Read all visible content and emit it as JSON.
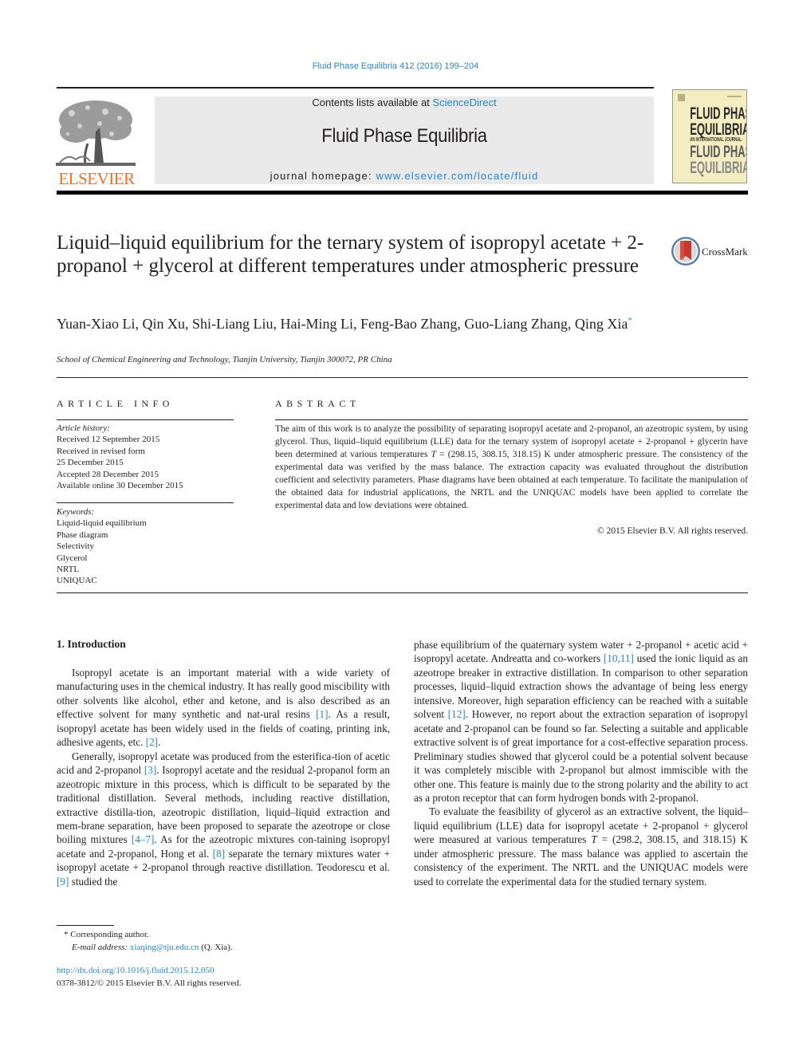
{
  "header": {
    "journal_reference": "Fluid Phase Equilibria 412 (2016) 199–204",
    "contents_prefix": "Contents lists available at ",
    "contents_link": "ScienceDirect",
    "journal_title": "Fluid Phase Equilibria",
    "homepage_prefix": "journal homepage: ",
    "homepage_link": "www.elsevier.com/locate/fluid",
    "publisher_logo_text": "ELSEVIER",
    "cover": {
      "lines": [
        "FLUID PHASE",
        "EQUILIBRIA",
        "AN INTERNATIONAL JOURNAL",
        "FLUID PHASE",
        "EQUILIBRIA"
      ]
    },
    "colors": {
      "link": "#2a85c6",
      "elsevier_orange": "#f37021",
      "banner_bg": "#e9e9e9",
      "cover_bg": "#f5edc2"
    }
  },
  "article": {
    "title": "Liquid–liquid equilibrium for the ternary system of isopropyl acetate + 2-propanol + glycerol at different temperatures under atmospheric pressure",
    "crossmark_label": "CrossMark",
    "authors": "Yuan-Xiao Li, Qin Xu, Shi-Liang Liu, Hai-Ming Li, Feng-Bao Zhang, Guo-Liang Zhang, Qing Xia",
    "corresponding_mark": "*",
    "affiliation": "School of Chemical Engineering and Technology, Tianjin University, Tianjin 300072, PR China"
  },
  "article_info": {
    "heading": "ARTICLE INFO",
    "history_label": "Article history:",
    "history": [
      "Received 12 September 2015",
      "Received in revised form",
      "25 December 2015",
      "Accepted 28 December 2015",
      "Available online 30 December 2015"
    ],
    "keywords_label": "Keywords:",
    "keywords": [
      "Liquid-liquid equilibrium",
      "Phase diagram",
      "Selectivity",
      "Glycerol",
      "NRTL",
      "UNIQUAC"
    ]
  },
  "abstract": {
    "heading": "ABSTRACT",
    "text_1": "The aim of this work is to analyze the possibility of separating isopropyl acetate and 2-propanol, an azeotropic system, by using glycerol. Thus, liquid–liquid equilibrium (LLE) data for the ternary system of isopropyl acetate + 2-propanol + glycerin have been determined at various temperatures ",
    "text_T": "T",
    "text_2": " = (298.15, 308.15, 318.15) K under atmospheric pressure. The consistency of the experimental data was verified by the mass balance. The extraction capacity was evaluated throughout the distribution coefficient and selectivity parameters. Phase diagrams have been obtained at each temperature. To facilitate the manipulation of the obtained data for industrial applications, the NRTL and the UNIQUAC models have been applied to correlate the experimental data and low deviations were obtained.",
    "copyright": "© 2015 Elsevier B.V. All rights reserved."
  },
  "introduction": {
    "heading": "1.  Introduction",
    "p1": [
      {
        "t": "Isopropyl acetate is an important material with a wide variety of manufacturing uses in the chemical industry. It has really good miscibility with other solvents like alcohol, ether and ketone, and is also described as an effective solvent for many synthetic and natural resins "
      },
      {
        "ref": "[1]"
      },
      {
        "t": ". As a result, isopropyl acetate has been widely used in the fields of coating, printing ink, adhesive agents, etc. "
      },
      {
        "ref": "[2]"
      },
      {
        "t": "."
      }
    ],
    "p2": [
      {
        "t": "Generally, isopropyl acetate was produced from the esterification of acetic acid and 2-propanol "
      },
      {
        "ref": "[3]"
      },
      {
        "t": ". Isopropyl acetate and the residual 2-propanol form an azeotropic mixture in this process, which is difficult to be separated by the traditional distillation. Several methods, including reactive distillation, extractive distillation, azeotropic distillation, liquid–liquid extraction and membrane separation, have been proposed to separate the azeotrope or close boiling mixtures "
      },
      {
        "ref": "[4–7]"
      },
      {
        "t": ". As for the azeotropic mixtures containing isopropyl acetate and 2-propanol, Hong et al. "
      },
      {
        "ref": "[8]"
      },
      {
        "t": " separate the ternary mixtures water + isopropyl acetate + 2-propanol through reactive distillation. Teodorescu et al. "
      },
      {
        "ref": "[9]"
      },
      {
        "t": " studied the phase equilibrium of the quaternary system water + 2-propanol + acetic acid + isopropyl acetate. Andreatta and co-workers "
      },
      {
        "ref": "[10,11]"
      },
      {
        "t": " used the ionic liquid as an azeotrope breaker in extractive distillation. In comparison to other separation processes, liquid–liquid extraction shows the advantage of being less energy intensive. Moreover, high separation efficiency can be reached with a suitable solvent "
      },
      {
        "ref": "[12]"
      },
      {
        "t": ". However, no report about the extraction separation of isopropyl acetate and 2-propanol can be found so far. Selecting a suitable and applicable extractive solvent is of great importance for a cost-effective separation process. Preliminary studies showed that glycerol could be a potential solvent because it was completely miscible with 2-propanol but almost immiscible with the other one. This feature is mainly due to the strong polarity and the ability to act as a proton receptor that can form hydrogen bonds with 2-propanol."
      }
    ],
    "p2_left_part": "Generally, isopropyl acetate was produced from the esterifica-tion of acetic acid and 2-propanol",
    "p3": [
      {
        "t": "To evaluate the feasibility of glycerol as an extractive solvent, the liquid–liquid equilibrium (LLE) data for isopropyl acetate + 2-propanol + glycerol were measured at various temperatures "
      },
      {
        "em": "T"
      },
      {
        "t": " = (298.2, 308.15, and 318.15) K under atmospheric pressure. The mass balance was applied to ascertain the consistency of the experiment. The NRTL and the UNIQUAC models were used to correlate the experimental data for the studied ternary system."
      }
    ]
  },
  "left_column": {
    "p1_a": "Isopropyl acetate is an important material with a wide variety of manufacturing uses in the chemical industry. It has really good miscibility with other solvents like alcohol, ether and ketone, and is also described as an effective solvent for many synthetic and nat-ural resins ",
    "ref1": "[1]",
    "p1_b": ". As a result, isopropyl acetate has been widely used in the fields of coating, printing ink, adhesive agents, etc. ",
    "ref2": "[2]",
    "p1_c": ".",
    "p2_a": "Generally, isopropyl acetate was produced from the esterifica-tion of acetic acid and 2-propanol ",
    "ref3": "[3]",
    "p2_b": ". Isopropyl acetate and the residual 2-propanol form an azeotropic mixture in this process, which is difficult to be separated by the traditional distillation. Several methods, including reactive distillation, extractive distilla-tion, azeotropic distillation, liquid–liquid extraction and mem-brane separation, have been proposed to separate the azeotrope or close boiling mixtures ",
    "ref4_7": "[4–7]",
    "p2_c": ". As for the azeotropic mixtures con-taining isopropyl acetate and 2-propanol, Hong et al. ",
    "ref8": "[8]",
    "p2_d": " separate the ternary mixtures water + isopropyl acetate + 2-propanol through reactive distillation. Teodorescu et al. ",
    "ref9": "[9]",
    "p2_e": " studied the"
  },
  "right_column": {
    "p2_cont_a": "phase equilibrium of the quaternary system water + 2-propanol + acetic acid + isopropyl acetate. Andreatta and co-workers ",
    "ref10_11": "[10,11]",
    "p2_cont_b": " used the ionic liquid as an azeotrope breaker in extractive distillation. In comparison to other separation processes, liquid–liquid extraction shows the advantage of being less energy intensive. Moreover, high separation efficiency can be reached with a suitable solvent ",
    "ref12": "[12]",
    "p2_cont_c": ". However, no report about the extraction separation of isopropyl acetate and 2-propanol can be found so far. Selecting a suitable and applicable extractive solvent is of great importance for a cost-effective separation process. Preliminary studies showed that glycerol could be a potential solvent because it was completely miscible with 2-propanol but almost immiscible with the other one. This feature is mainly due to the strong polarity and the ability to act as a proton receptor that can form hydrogen bonds with 2-propanol.",
    "p3_a": "To evaluate the feasibility of glycerol as an extractive solvent, the liquid–liquid equilibrium (LLE) data for isopropyl acetate + 2-propanol + glycerol were measured at various temperatures ",
    "p3_T": "T",
    "p3_b": " = (298.2, 308.15, and 318.15) K under atmospheric pressure. The mass balance was applied to ascertain the consistency of the experiment. The NRTL and the UNIQUAC models were used to correlate the experimental data for the studied ternary system."
  },
  "footnotes": {
    "corresponding": "*  Corresponding author.",
    "email_label": "E-mail address: ",
    "email": "xiaqing@tju.edu.cn",
    "email_suffix": " (Q. Xia).",
    "doi": "http://dx.doi.org/10.1016/j.fluid.2015.12.050",
    "issn_line": "0378-3812/© 2015 Elsevier B.V. All rights reserved."
  }
}
